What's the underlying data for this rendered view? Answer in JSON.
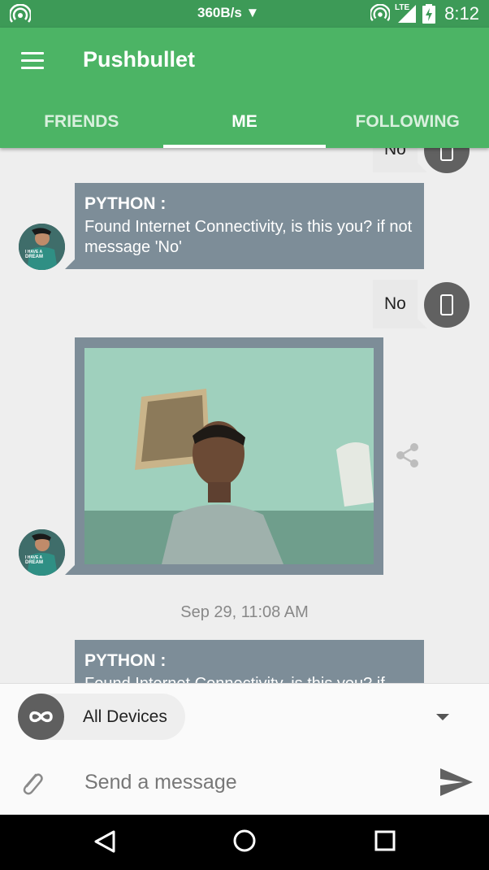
{
  "status_bar": {
    "network_speed": "360B/s ▼",
    "network_type": "LTE",
    "time": "8:12",
    "icons": [
      "hotspot-icon",
      "hotspot-icon",
      "signal-icon",
      "battery-charging-icon"
    ]
  },
  "app_bar": {
    "title": "Pushbullet",
    "menu_icon": "hamburger-menu-icon"
  },
  "tabs": [
    {
      "label": "FRIENDS",
      "active": false
    },
    {
      "label": "ME",
      "active": true
    },
    {
      "label": "FOLLOWING",
      "active": false
    }
  ],
  "feed": {
    "messages": [
      {
        "type": "outgoing",
        "text": "No"
      },
      {
        "type": "incoming",
        "sender": "PYTHON :",
        "text": "Found Internet Connectivity, is this you? if not message 'No'"
      },
      {
        "type": "outgoing",
        "text": "No"
      },
      {
        "type": "incoming-image"
      },
      {
        "type": "date-separator",
        "text": "Sep 29, 11:08 AM"
      },
      {
        "type": "incoming",
        "sender": "PYTHON :",
        "text": "Found Internet Connectivity, is this you? if"
      }
    ],
    "avatar_text": "I HAVE A DREAM WORTH MORE THAN MY SLEEP",
    "device_icon": "phone-icon",
    "share_icon": "share-icon"
  },
  "device_selector": {
    "label": "All Devices",
    "icon": "infinity-icon"
  },
  "composer": {
    "placeholder": "Send a message",
    "attach_icon": "paperclip-icon",
    "send_icon": "send-icon"
  },
  "colors": {
    "app_bar": "#4cb465",
    "status_bar": "#3d9a57",
    "incoming_bubble": "#7d8d98",
    "outgoing_bubble": "#e9e9e9"
  }
}
